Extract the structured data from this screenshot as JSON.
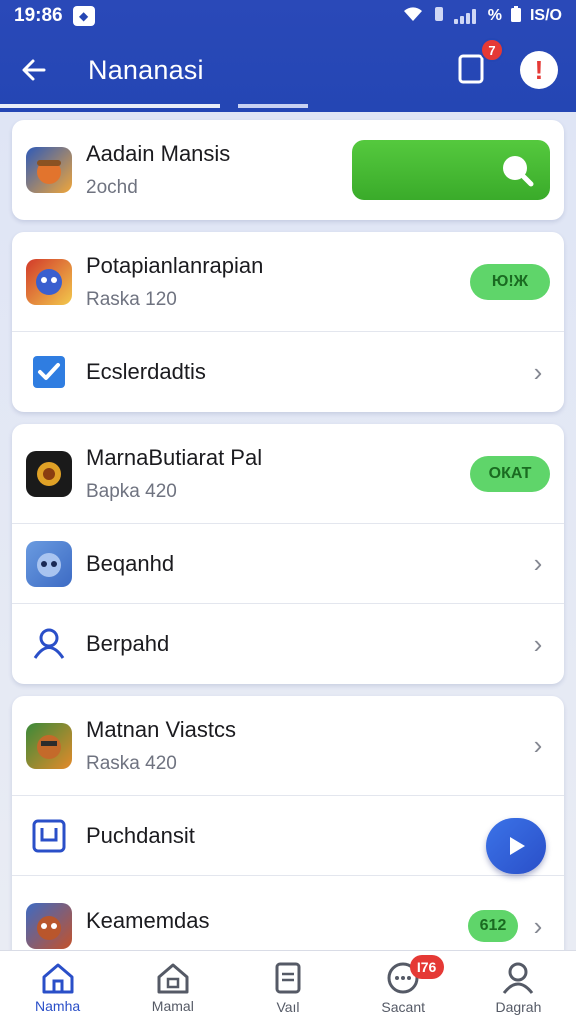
{
  "status_bar": {
    "time": "19:86",
    "battery": "% ",
    "right_text": "IS/O"
  },
  "header": {
    "title": "Nananasi",
    "notification_badge": "7"
  },
  "list": {
    "featured": {
      "name": "Aadain Mansis",
      "sub": "2ochd"
    },
    "group2": {
      "app": {
        "name": "Potapianlanrapian",
        "sub": "Raska 120",
        "pill": "Ю!Ж"
      },
      "link": {
        "label": "Ecslerdadtis"
      }
    },
    "group3": {
      "app": {
        "name": "MarnaButiarat Pal",
        "sub": "Bapka 420",
        "pill": "ОКАТ"
      },
      "link1": {
        "label": "Beqanhd"
      },
      "link2": {
        "label": "Berpahd"
      }
    },
    "group4": {
      "app": {
        "name": "Matnan Viastcs",
        "sub": "Raska 420"
      },
      "link": {
        "label": "Puchdansit"
      },
      "app2": {
        "name": "Keamemdas",
        "sub": "",
        "pill": "612"
      }
    }
  },
  "bottom_nav": {
    "items": [
      {
        "label": "Namha"
      },
      {
        "label": "Mamal"
      },
      {
        "label": "Vaıl"
      },
      {
        "label": "Sacant",
        "badge": "I76"
      },
      {
        "label": "Dagrah"
      }
    ]
  },
  "colors": {
    "primary": "#2446b4",
    "accent_green": "#5fd56a",
    "badge_red": "#e53935"
  }
}
